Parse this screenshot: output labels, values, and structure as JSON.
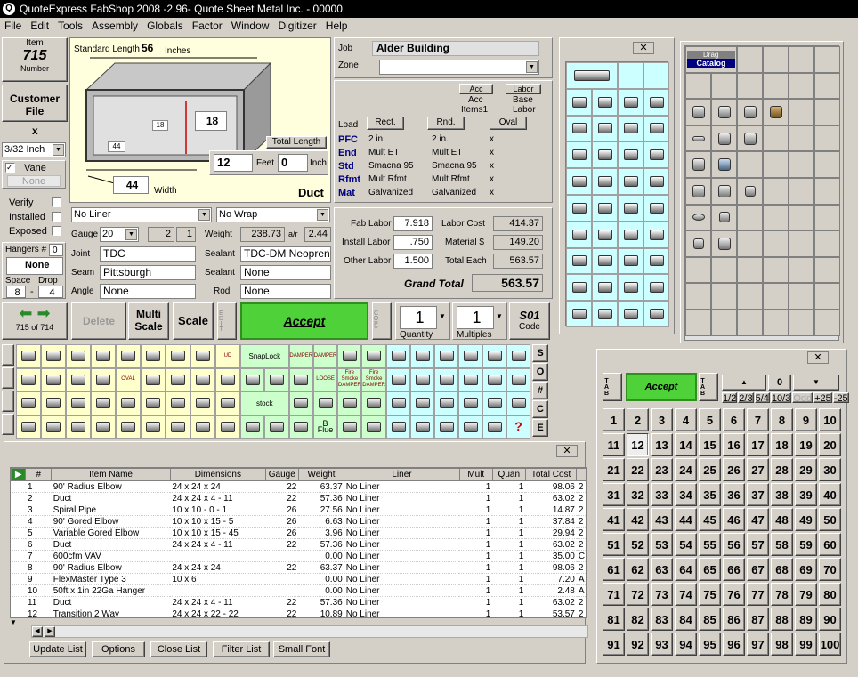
{
  "titlebar": {
    "title": "QuoteExpress FabShop 2008 -2.96- Quote Sheet Metal Inc.  -  00000"
  },
  "menu": [
    "File",
    "Edit",
    "Tools",
    "Assembly",
    "Globals",
    "Factor",
    "Window",
    "Digitizer",
    "Help"
  ],
  "item": {
    "label": "Item",
    "number": "715",
    "caption": "Number"
  },
  "customer_file": "Customer File",
  "x_label": "x",
  "gauge_combo": "3/32 Inch",
  "vane": {
    "label": "Vane",
    "value": "None"
  },
  "checks": [
    "Verify",
    "Installed",
    "Exposed"
  ],
  "hangers": {
    "label": "Hangers #",
    "count": "0",
    "value": "None",
    "space_label": "Space",
    "drop_label": "Drop",
    "space": "8",
    "drop": "4"
  },
  "diagram": {
    "std_length_label": "Standard Length",
    "std_length": "56",
    "inches": "Inches",
    "dim_18a": "18",
    "dim_18b": "18",
    "dim_44a": "44",
    "dim_44b": "44",
    "width_label": "Width",
    "total_length_btn": "Total Length",
    "feet_value": "12",
    "feet_label": "Feet",
    "inch_value": "0",
    "inch_label": "Inch",
    "item_name": "Duct"
  },
  "job": {
    "job_label": "Job",
    "job_value": "Alder Building",
    "zone_label": "Zone",
    "zone_value": ""
  },
  "acc": {
    "acc_btn": "Acc",
    "acc_text": "Acc",
    "acc_items": "Items1",
    "labor_btn": "Labor",
    "base": "Base",
    "labor_text": "Labor"
  },
  "load": {
    "load_label": "Load",
    "rect": "Rect.",
    "rnd": "Rnd.",
    "oval": "Oval"
  },
  "specs": [
    {
      "key": "PFC",
      "a": "2 in.",
      "b": "2 in.",
      "c": "x"
    },
    {
      "key": "End",
      "a": "Mult ET",
      "b": "Mult ET",
      "c": "x"
    },
    {
      "key": "Std",
      "a": "Smacna 95",
      "b": "Smacna 95",
      "c": "x"
    },
    {
      "key": "Rfmt",
      "a": "Mult Rfmt",
      "b": "Mult Rfmt",
      "c": "x"
    },
    {
      "key": "Mat",
      "a": "Galvanized",
      "b": "Galvanized",
      "c": "x"
    }
  ],
  "liner": "No Liner",
  "wrap": "No Wrap",
  "props": {
    "gauge_label": "Gauge",
    "gauge": "20",
    "g2": "2",
    "g1": "1",
    "weight_label": "Weight",
    "weight": "238.73",
    "af_label": "a/r",
    "af": "2.44",
    "joint_label": "Joint",
    "joint": "TDC",
    "sealant_label": "Sealant",
    "sealant1": "TDC-DM Neopren",
    "seam_label": "Seam",
    "seam": "Pittsburgh",
    "sealant2_label": "Sealant",
    "sealant2": "None",
    "angle_label": "Angle",
    "angle": "None",
    "rod_label": "Rod",
    "rod": "None"
  },
  "labor": {
    "fab_label": "Fab Labor",
    "fab": "7.918",
    "labor_cost_label": "Labor Cost",
    "labor_cost": "414.37",
    "install_label": "Install Labor",
    "install": ".750",
    "material_label": "Material $",
    "material": "149.20",
    "other_label": "Other Labor",
    "other": "1.500",
    "total_each_label": "Total Each",
    "total_each": "563.57",
    "grand_total_label": "Grand Total",
    "grand_total": "563.57"
  },
  "actions": {
    "nav_pos": "715",
    "nav_of": "of",
    "nav_total": "714",
    "delete": "Delete",
    "multi": "Multi",
    "scale_label": "Scale",
    "scale": "Scale",
    "edit": "EDIT",
    "accept": "Accept",
    "copy": "COPY",
    "quantity": "1",
    "quantity_label": "Quantity",
    "multiples": "1",
    "multiples_label": "Multiples",
    "code": "S01",
    "code_label": "Code"
  },
  "tool_labels": {
    "ud": "UD",
    "snaplock": "SnapLock",
    "damper1": "DAMPER",
    "damper2": "DAMPER",
    "loose": "LOOSE",
    "fire1": "Fire",
    "smoke1": "Smoke DAMPER",
    "fire2": "Fire",
    "smoke2": "Smoke DAMPER",
    "stock": "stock",
    "oval": "OVAL",
    "b_flue": "B Flue"
  },
  "side_letters": [
    "S",
    "O",
    "#",
    "C",
    "E"
  ],
  "list": {
    "columns": [
      "#",
      "Item Name",
      "Dimensions",
      "Gauge",
      "Weight",
      "Liner",
      "Mult",
      "Quan",
      "Total Cost"
    ],
    "rows": [
      [
        "1",
        "90' Radius Elbow",
        "24 x 24 x 24",
        "22",
        "63.37",
        "No Liner",
        "1",
        "1",
        "98.06",
        "2"
      ],
      [
        "2",
        "Duct",
        "24 x 24 x 4 - 11",
        "22",
        "57.36",
        "No Liner",
        "1",
        "1",
        "63.02",
        "2"
      ],
      [
        "3",
        "Spiral Pipe",
        "10 x 10 - 0 - 1",
        "26",
        "27.56",
        "No Liner",
        "1",
        "1",
        "14.87",
        "2"
      ],
      [
        "4",
        "90' Gored Elbow",
        "10 x 10 x 15 - 5",
        "26",
        "6.63",
        "No Liner",
        "1",
        "1",
        "37.84",
        "2"
      ],
      [
        "5",
        "Variable Gored Elbow",
        "10 x 10 x 15 - 45",
        "26",
        "3.96",
        "No Liner",
        "1",
        "1",
        "29.94",
        "2"
      ],
      [
        "6",
        "Duct",
        "24 x 24 x 4 - 11",
        "22",
        "57.36",
        "No Liner",
        "1",
        "1",
        "63.02",
        "2"
      ],
      [
        "7",
        "600cfm VAV",
        "",
        "",
        "0.00",
        "No Liner",
        "1",
        "1",
        "35.00",
        "C"
      ],
      [
        "8",
        "90' Radius Elbow",
        "24 x 24 x 24",
        "22",
        "63.37",
        "No Liner",
        "1",
        "1",
        "98.06",
        "2"
      ],
      [
        "9",
        "FlexMaster Type 3",
        "10 x 6",
        "",
        "0.00",
        "No Liner",
        "1",
        "1",
        "7.20",
        "A"
      ],
      [
        "10",
        "50ft x 1in 22Ga Hanger",
        "",
        "",
        "0.00",
        "No Liner",
        "1",
        "1",
        "2.48",
        "A"
      ],
      [
        "11",
        "Duct",
        "24 x 24 x 4 - 11",
        "22",
        "57.36",
        "No Liner",
        "1",
        "1",
        "63.02",
        "2"
      ],
      [
        "12",
        "Transition 2 Way",
        "24 x 24 x 22 - 22",
        "22",
        "10.89",
        "No Liner",
        "1",
        "1",
        "53.57",
        "2"
      ]
    ],
    "buttons": [
      "Update List",
      "Options",
      "Close List",
      "Filter List",
      "Small Font"
    ]
  },
  "catalog": {
    "drag": "Drag",
    "catalog": "Catalog"
  },
  "numpad": {
    "tab_left": "TAB",
    "accept": "Accept",
    "tab_right": "TAB",
    "up": "▲",
    "zero": "0",
    "down": "▼",
    "fractions": [
      "1/2",
      "2/3",
      "5/4",
      "10/3",
      "Odd",
      "+25",
      "-25"
    ],
    "numbers": [
      "1",
      "2",
      "3",
      "4",
      "5",
      "6",
      "7",
      "8",
      "9",
      "10",
      "11",
      "12",
      "13",
      "14",
      "15",
      "16",
      "17",
      "18",
      "19",
      "20",
      "21",
      "22",
      "23",
      "24",
      "25",
      "26",
      "27",
      "28",
      "29",
      "30",
      "31",
      "32",
      "33",
      "34",
      "35",
      "36",
      "37",
      "38",
      "39",
      "40",
      "41",
      "42",
      "43",
      "44",
      "45",
      "46",
      "47",
      "48",
      "49",
      "50",
      "51",
      "52",
      "53",
      "54",
      "55",
      "56",
      "57",
      "58",
      "59",
      "60",
      "61",
      "62",
      "63",
      "64",
      "65",
      "66",
      "67",
      "68",
      "69",
      "70",
      "71",
      "72",
      "73",
      "74",
      "75",
      "76",
      "77",
      "78",
      "79",
      "80",
      "81",
      "82",
      "83",
      "84",
      "85",
      "86",
      "87",
      "88",
      "89",
      "90",
      "91",
      "92",
      "93",
      "94",
      "95",
      "96",
      "97",
      "98",
      "99",
      "100"
    ]
  },
  "colors": {
    "accent_green": "#4fd13a",
    "yellow_panel": "#ffffdd",
    "navy": "#000080",
    "tool_yellow": "#ffffcc",
    "tool_green": "#ccffcc",
    "tool_blue": "#ccffff"
  }
}
